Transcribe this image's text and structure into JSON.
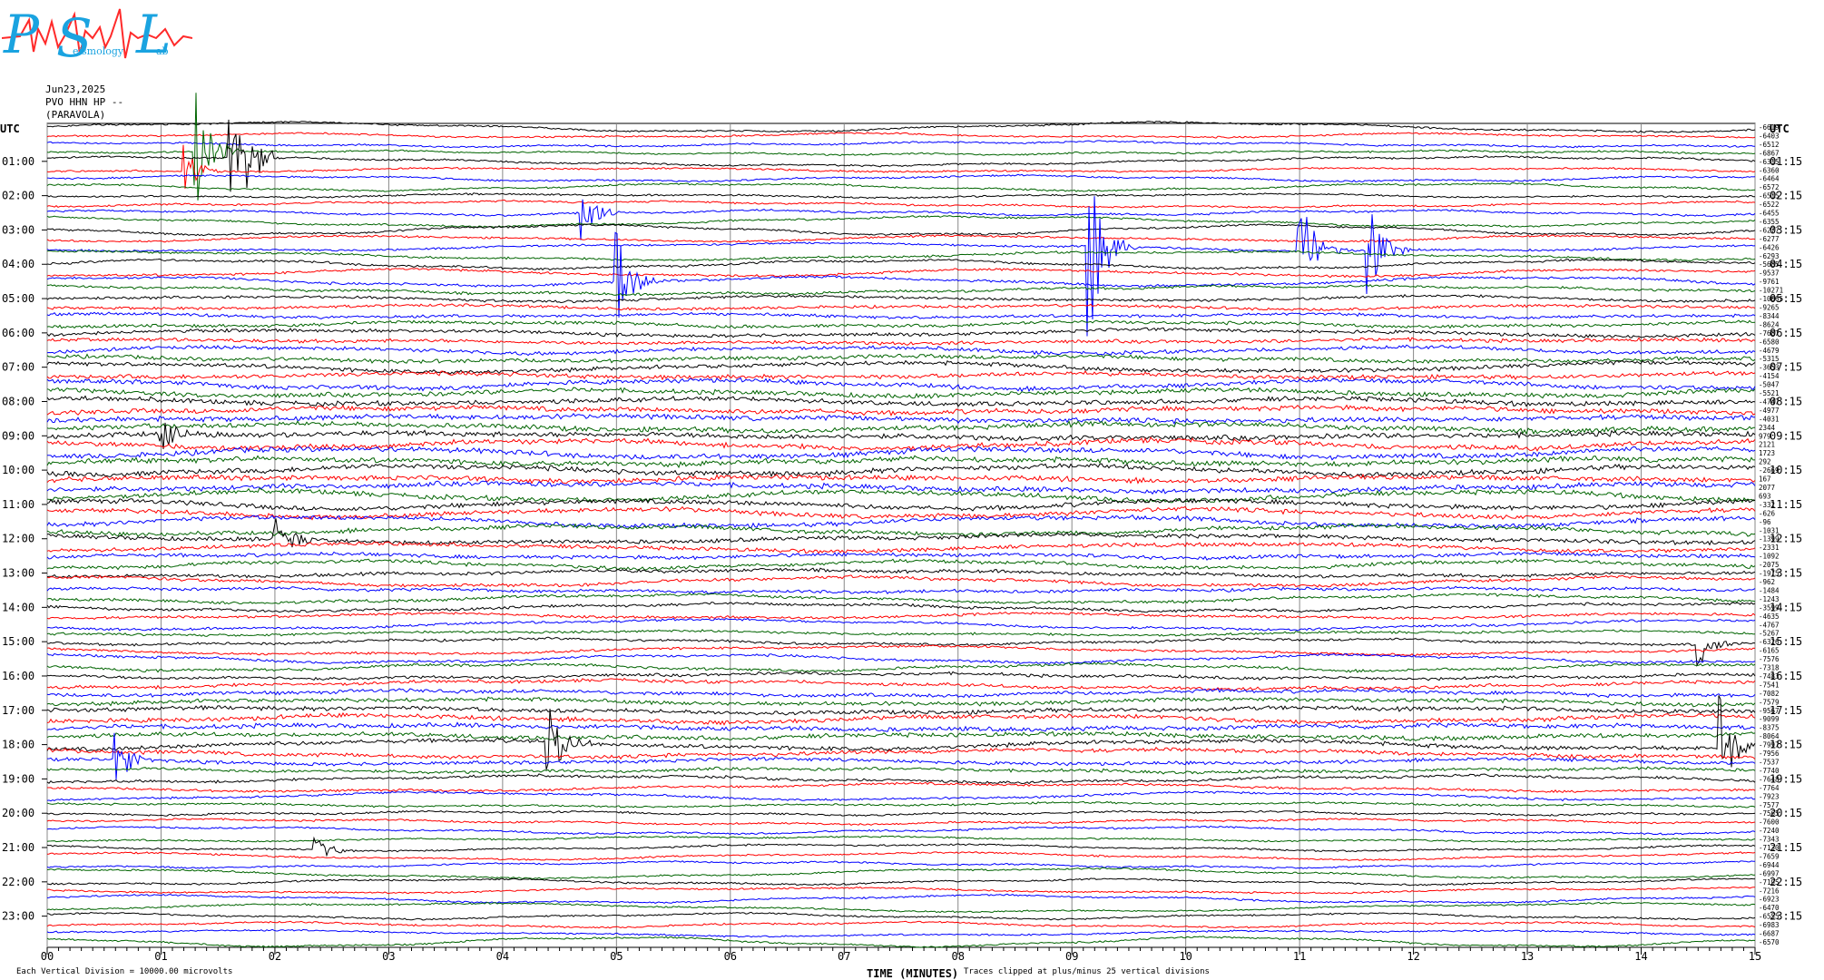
{
  "header": {
    "date": "Jun23,2025",
    "station": "PVO HHN HP --",
    "location": "(PARAVOLA)"
  },
  "logo": {
    "p": "P",
    "s": "S",
    "l": "L",
    "sub_left": "eismology",
    "sub_right": "ab"
  },
  "footer": {
    "scale_note": "Each Vertical Division = 10000.00 microvolts",
    "clip_note": "Traces clipped at plus/minus 25 vertical divisions"
  },
  "colors": {
    "black": "#000000",
    "red": "#ff0000",
    "blue": "#0000ff",
    "green": "#006400",
    "grid": "#888888"
  },
  "chart_data": {
    "type": "line",
    "title": "",
    "xlabel": "TIME (MINUTES)",
    "ylabel": "",
    "left_axis_label": "UTC",
    "right_axis_label": "UTC",
    "xlim": [
      0,
      15
    ],
    "x_ticks": [
      "00",
      "01",
      "02",
      "03",
      "04",
      "05",
      "06",
      "07",
      "08",
      "09",
      "10",
      "11",
      "12",
      "13",
      "14",
      "15"
    ],
    "left_hour_labels": [
      "01:00",
      "02:00",
      "03:00",
      "04:00",
      "05:00",
      "06:00",
      "07:00",
      "08:00",
      "09:00",
      "10:00",
      "11:00",
      "12:00",
      "13:00",
      "14:00",
      "15:00",
      "16:00",
      "17:00",
      "18:00",
      "19:00",
      "20:00",
      "21:00",
      "22:00",
      "23:00"
    ],
    "right_hour_labels": [
      "01:15",
      "02:15",
      "03:15",
      "04:15",
      "05:15",
      "06:15",
      "07:15",
      "08:15",
      "09:15",
      "10:15",
      "11:15",
      "12:15",
      "13:15",
      "14:15",
      "15:15",
      "16:15",
      "17:15",
      "18:15",
      "19:15",
      "20:15",
      "21:15",
      "22:15",
      "23:15"
    ],
    "trace_colors": [
      "black",
      "red",
      "blue",
      "green"
    ],
    "trace_count": 96,
    "trace_offsets": [
      -6619,
      -6403,
      -6512,
      -6867,
      -6315,
      -6360,
      -6464,
      -6572,
      -6515,
      -6522,
      -6455,
      -6355,
      -6277,
      -6277,
      -6426,
      -6293,
      -5685,
      -9537,
      -9761,
      -10271,
      -10065,
      -9265,
      -8344,
      -8624,
      -7687,
      -6580,
      -4679,
      -5315,
      -3653,
      -4154,
      -5047,
      -5521,
      -4747,
      -4977,
      -4031,
      2344,
      979,
      2121,
      1723,
      292,
      -2669,
      167,
      2077,
      693,
      -332,
      -626,
      -96,
      -1031,
      -1399,
      -2331,
      -1092,
      -2075,
      -1975,
      -962,
      -1484,
      -1243,
      -3599,
      -4635,
      -4767,
      -5267,
      -6326,
      -6165,
      -7576,
      -7318,
      -7483,
      -7541,
      -7082,
      -7579,
      -9567,
      -9099,
      -8375,
      -8064,
      -7997,
      -7956,
      -7537,
      -7740,
      -7648,
      -7764,
      -7923,
      -7577,
      -7565,
      -7600,
      -7240,
      -7343,
      -7130,
      -7659,
      -6944,
      -6997,
      -7195,
      -7216,
      -6923,
      -6470,
      -6555,
      -6983,
      -6687,
      -6570
    ],
    "scale_microvolts_per_division": 10000.0,
    "clip_divisions": 25,
    "events": [
      {
        "trace": 3,
        "minute": 1.3,
        "amp": 80,
        "color": "blue"
      },
      {
        "trace": 4,
        "minute": 1.6,
        "amp": 55,
        "color": "blue"
      },
      {
        "trace": 4,
        "minute": 1.75,
        "amp": 45,
        "color": "blue"
      },
      {
        "trace": 5,
        "minute": 1.2,
        "amp": 30,
        "color": "blue"
      },
      {
        "trace": 14,
        "minute": 9.15,
        "amp": 110,
        "color": "blue"
      },
      {
        "trace": 14,
        "minute": 11.0,
        "amp": 70,
        "color": "blue"
      },
      {
        "trace": 14,
        "minute": 11.6,
        "amp": 55,
        "color": "blue"
      },
      {
        "trace": 10,
        "minute": 4.7,
        "amp": 35,
        "color": "blue"
      },
      {
        "trace": 18,
        "minute": 5.0,
        "amp": 60,
        "color": "red"
      },
      {
        "trace": 36,
        "minute": 1.0,
        "amp": 25,
        "color": "green"
      },
      {
        "trace": 48,
        "minute": 2.0,
        "amp": 40,
        "color": "green"
      },
      {
        "trace": 60,
        "minute": 14.5,
        "amp": 30,
        "color": "green"
      },
      {
        "trace": 72,
        "minute": 4.4,
        "amp": 55,
        "color": "red"
      },
      {
        "trace": 72,
        "minute": 14.7,
        "amp": 60,
        "color": "red"
      },
      {
        "trace": 74,
        "minute": 0.6,
        "amp": 35,
        "color": "blue"
      },
      {
        "trace": 84,
        "minute": 2.35,
        "amp": 18,
        "color": "green"
      }
    ]
  }
}
